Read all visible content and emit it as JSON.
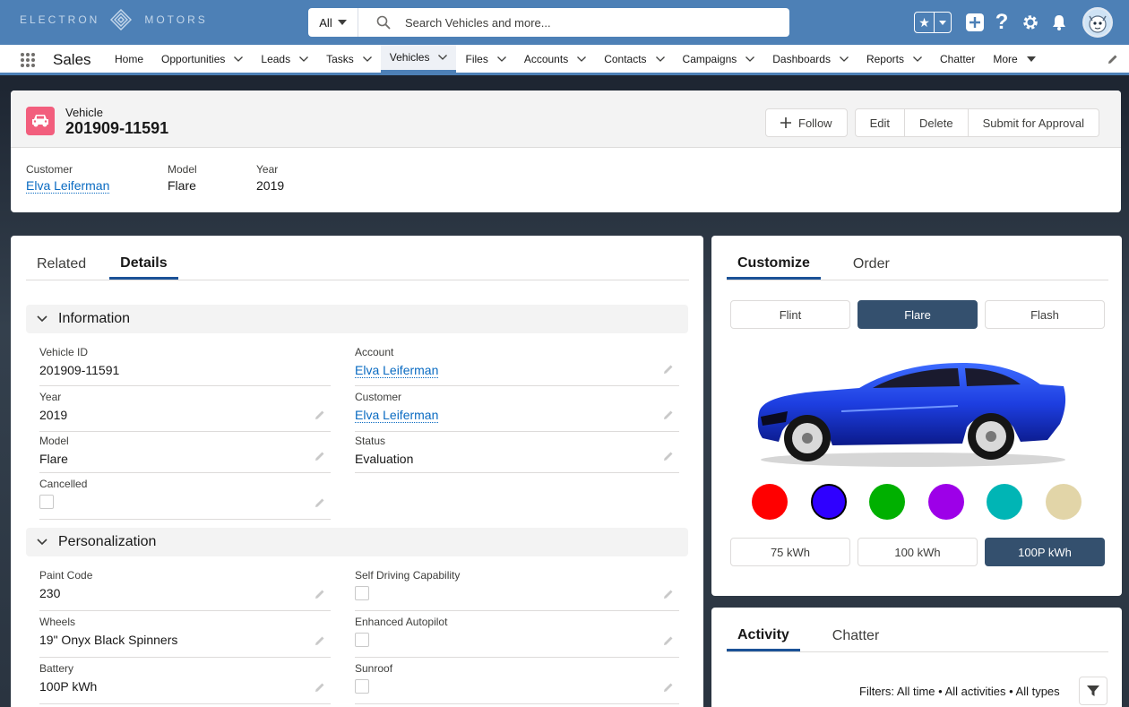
{
  "header": {
    "logo_left": "ELECTRON",
    "logo_right": "MOTORS",
    "search_scope": "All",
    "search_placeholder": "Search Vehicles and more..."
  },
  "nav": {
    "app_name": "Sales",
    "items": [
      {
        "label": "Home",
        "chevron": false
      },
      {
        "label": "Opportunities",
        "chevron": true
      },
      {
        "label": "Leads",
        "chevron": true
      },
      {
        "label": "Tasks",
        "chevron": true
      },
      {
        "label": "Vehicles",
        "chevron": true,
        "active": true
      },
      {
        "label": "Files",
        "chevron": true
      },
      {
        "label": "Accounts",
        "chevron": true
      },
      {
        "label": "Contacts",
        "chevron": true
      },
      {
        "label": "Campaigns",
        "chevron": true
      },
      {
        "label": "Dashboards",
        "chevron": true
      },
      {
        "label": "Reports",
        "chevron": true
      },
      {
        "label": "Chatter",
        "chevron": false
      },
      {
        "label": "More",
        "chevron": true
      }
    ]
  },
  "record": {
    "object_label": "Vehicle",
    "title": "201909-11591",
    "buttons": {
      "follow": "Follow",
      "edit": "Edit",
      "delete": "Delete",
      "submit": "Submit for Approval"
    },
    "highlights": [
      {
        "label": "Customer",
        "value": "Elva Leiferman",
        "link": true
      },
      {
        "label": "Model",
        "value": "Flare",
        "link": false
      },
      {
        "label": "Year",
        "value": "2019",
        "link": false
      }
    ]
  },
  "details": {
    "tabs": [
      "Related",
      "Details"
    ],
    "selected_tab": "Details",
    "information_title": "Information",
    "personalization_title": "Personalization",
    "info_left": [
      {
        "label": "Vehicle ID",
        "value": "201909-11591"
      },
      {
        "label": "Year",
        "value": "2019"
      },
      {
        "label": "Model",
        "value": "Flare"
      },
      {
        "label": "Cancelled",
        "value": ""
      }
    ],
    "info_right": [
      {
        "label": "Account",
        "value": "Elva Leiferman"
      },
      {
        "label": "Customer",
        "value": "Elva Leiferman"
      },
      {
        "label": "Status",
        "value": "Evaluation"
      }
    ],
    "pers_left": [
      {
        "label": "Paint Code",
        "value": "230"
      },
      {
        "label": "Wheels",
        "value": "19\" Onyx Black Spinners"
      },
      {
        "label": "Battery",
        "value": "100P kWh"
      }
    ],
    "pers_right": [
      {
        "label": "Self Driving Capability",
        "value": ""
      },
      {
        "label": "Enhanced Autopilot",
        "value": ""
      },
      {
        "label": "Sunroof",
        "value": ""
      }
    ]
  },
  "customize": {
    "tabs": [
      "Customize",
      "Order"
    ],
    "models": [
      "Flint",
      "Flare",
      "Flash"
    ],
    "selected_model": "Flare",
    "colors": [
      "#ff0000",
      "#2f00ff",
      "#00b000",
      "#9d00e8",
      "#00b5b5",
      "#e2d5a8"
    ],
    "selected_color": "#2f00ff",
    "batteries": [
      "75 kWh",
      "100 kWh",
      "100P kWh"
    ],
    "selected_battery": "100P kWh"
  },
  "activity": {
    "tabs": [
      "Activity",
      "Chatter"
    ],
    "filters": "Filters: All time • All activities • All types"
  },
  "colors": {
    "brand": "#4d80b6",
    "link": "#0a6bc2",
    "selected_button": "#34506e",
    "vehicle_icon": "#f25e7d"
  }
}
